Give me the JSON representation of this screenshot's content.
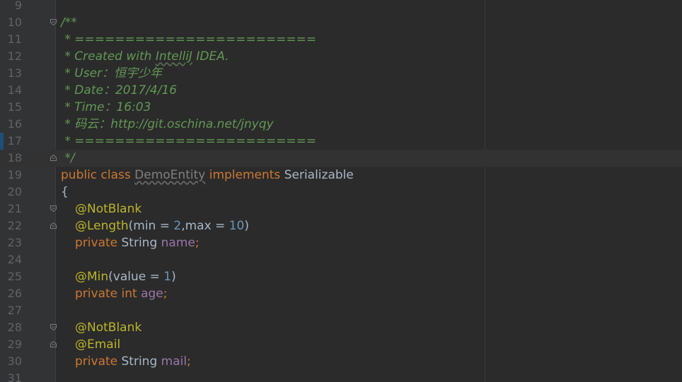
{
  "editor": {
    "lines": [
      {
        "n": "9"
      },
      {
        "n": "10",
        "text": "/**"
      },
      {
        "n": "11",
        "text": " * ========================"
      },
      {
        "n": "12",
        "a": " * Created with ",
        "b": "IntelliJ",
        "c": " IDEA."
      },
      {
        "n": "13",
        "text": " * User：恒宇少年"
      },
      {
        "n": "14",
        "text": " * Date：2017/4/16"
      },
      {
        "n": "15",
        "text": " * Time：16:03"
      },
      {
        "n": "16",
        "text": " * 码云：http://git.oschina.net/jnyqy"
      },
      {
        "n": "17",
        "text": " * ========================"
      },
      {
        "n": "18",
        "text": " */"
      },
      {
        "n": "19",
        "kw": "public class ",
        "name": "DemoEntity",
        "impl": " implements ",
        "iface": "Serializable"
      },
      {
        "n": "20",
        "text": "{"
      },
      {
        "n": "21",
        "ann": "@NotBlank"
      },
      {
        "n": "22",
        "ann": "@Length",
        "p1": "(min = ",
        "v1": "2",
        "p2": ",max = ",
        "v2": "10",
        "p3": ")"
      },
      {
        "n": "23",
        "kw": "private ",
        "type": "String ",
        "field": "name",
        "end": ";"
      },
      {
        "n": "24"
      },
      {
        "n": "25",
        "ann": "@Min",
        "p1": "(value = ",
        "v1": "1",
        "p3": ")"
      },
      {
        "n": "26",
        "kw": "private int ",
        "field": "age",
        "end": ";"
      },
      {
        "n": "27"
      },
      {
        "n": "28",
        "ann": "@NotBlank"
      },
      {
        "n": "29",
        "ann": "@Email"
      },
      {
        "n": "30",
        "kw": "private ",
        "type": "String ",
        "field": "mail",
        "end": ";"
      },
      {
        "n": "31"
      }
    ]
  },
  "colors": {
    "background": "#2b2b2b",
    "gutter": "#313335",
    "comment": "#629755",
    "keyword": "#cc7832",
    "annotation": "#bbb529",
    "number": "#6897bb",
    "field": "#9876aa",
    "text": "#a9b7c6",
    "line_number": "#606366"
  }
}
